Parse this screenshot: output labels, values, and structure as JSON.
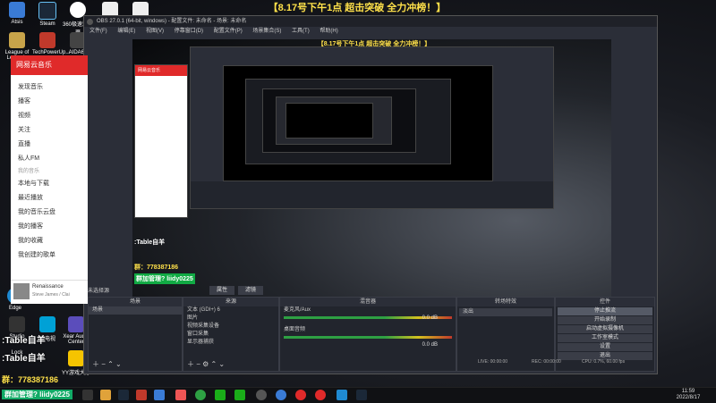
{
  "banner": "【8.17号下午1点 超击突破 全力冲榜！】",
  "desktop_icons": [
    {
      "label": "Atsis"
    },
    {
      "label": "Steam"
    },
    {
      "label": "360极速浏览器"
    },
    {
      "label": ""
    },
    {
      "label": ""
    },
    {
      "label": "League of Legends"
    },
    {
      "label": "TechPowerUp..."
    },
    {
      "label": "AIDA64"
    },
    {
      "label": "Edge"
    },
    {
      "label": "Studio"
    },
    {
      "label": "小电视"
    },
    {
      "label": "Xear Audio Center"
    },
    {
      "label": "Lock"
    },
    {
      "label": "YY游戏大厅"
    }
  ],
  "music": {
    "app_title": "网易云音乐",
    "nav": [
      "发现音乐",
      "播客",
      "视频",
      "关注",
      "直播",
      "私人FM"
    ],
    "section": "我的音乐",
    "my_items": [
      "本地与下载",
      "最近播放",
      "我的音乐云盘",
      "我的播客",
      "我的收藏"
    ],
    "created": "我创建的歌单",
    "track": "Renaissance",
    "artist": "Steve James / Clai"
  },
  "obs": {
    "title": "OBS 27.0.1 (64-bit, windows) - 配置文件: 未命名 - 场景: 未命名",
    "menu": [
      "文件(F)",
      "编辑(E)",
      "视图(V)",
      "停靠窗口(D)",
      "配置文件(P)",
      "场景集合(S)",
      "工具(T)",
      "帮助(H)"
    ],
    "no_source": "未选择源",
    "props_btn": "属性",
    "filters_btn": "滤镜",
    "docks": {
      "scenes": {
        "header": "场景",
        "items": [
          "场景"
        ]
      },
      "sources": {
        "header": "来源",
        "items": [
          "文本 (GDI+) 6",
          "图片",
          "视频采集设备",
          "窗口采集",
          "显示器捕获"
        ]
      },
      "mixer": {
        "header": "混音器",
        "tracks": [
          {
            "name": "麦克风/Aux",
            "db": "0.0 dB"
          },
          {
            "name": "桌面音频",
            "db": "0.0 dB"
          }
        ]
      },
      "transitions": {
        "header": "转场特效",
        "selected": "淡出",
        "duration_label": "时长",
        "duration": "300 ms"
      },
      "controls": {
        "header": "控件",
        "buttons": [
          "停止推流",
          "开始录制",
          "启动虚拟摄像机",
          "工作室模式",
          "设置",
          "退出"
        ]
      }
    },
    "status": {
      "live": "LIVE: 00:00:00",
      "rec": "REC: 00:00:00",
      "cpu": "CPU: 0.7%, 60.00 fps"
    }
  },
  "overlay": {
    "table_text": ":Table自羊",
    "qq_text": "群：778387186",
    "group_text": "群加管理? liidy0225"
  },
  "clock": {
    "time": "11:59",
    "date": "2022/8/17"
  },
  "colors": {
    "banner": "#ffe14a",
    "music_red": "#e02a2a",
    "obs_bg": "#2b2e38"
  }
}
